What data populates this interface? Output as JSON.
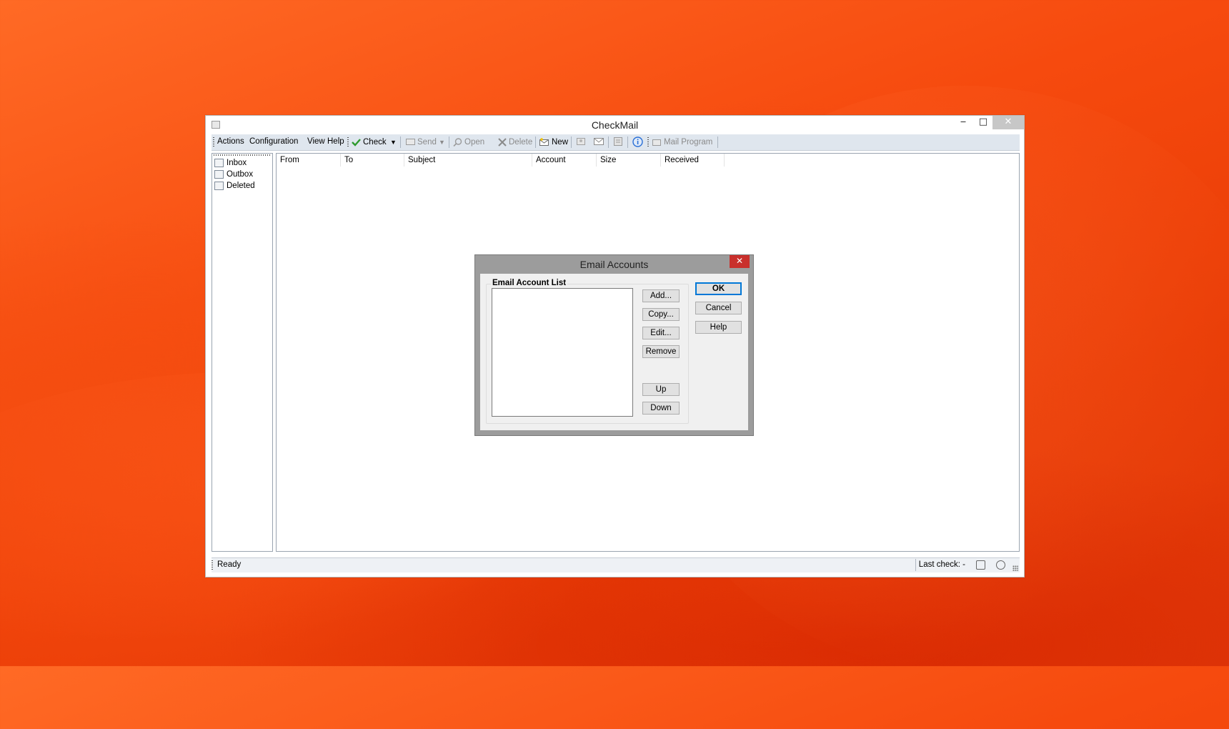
{
  "window": {
    "title": "CheckMail",
    "controls": {
      "minimize": "‒",
      "maximize": "□",
      "close": "✕"
    }
  },
  "menu": [
    "Actions",
    "Configuration",
    "View",
    "Help"
  ],
  "toolbar": {
    "check": "Check",
    "send": "Send",
    "open": "Open",
    "delete": "Delete",
    "new": "New",
    "mail_program": "Mail Program",
    "dropdown_arrow": "▼"
  },
  "folders": [
    "Inbox",
    "Outbox",
    "Deleted"
  ],
  "columns": [
    "From",
    "To",
    "Subject",
    "Account",
    "Size",
    "Received"
  ],
  "status": {
    "text": "Ready",
    "last_check": "Last check: -"
  },
  "dialog": {
    "title": "Email Accounts",
    "close": "✕",
    "group_label": "Email Account List",
    "buttons": {
      "add": "Add...",
      "copy": "Copy...",
      "edit": "Edit...",
      "remove": "Remove",
      "up": "Up",
      "down": "Down",
      "ok": "OK",
      "cancel": "Cancel",
      "help": "Help"
    }
  },
  "colors": {
    "toolbar_bg": "#dfe6ee",
    "dialog_frame": "#9c9c9c",
    "close_red": "#c9302c",
    "check_green": "#2e9a2e",
    "info_blue": "#2a6fd6"
  }
}
